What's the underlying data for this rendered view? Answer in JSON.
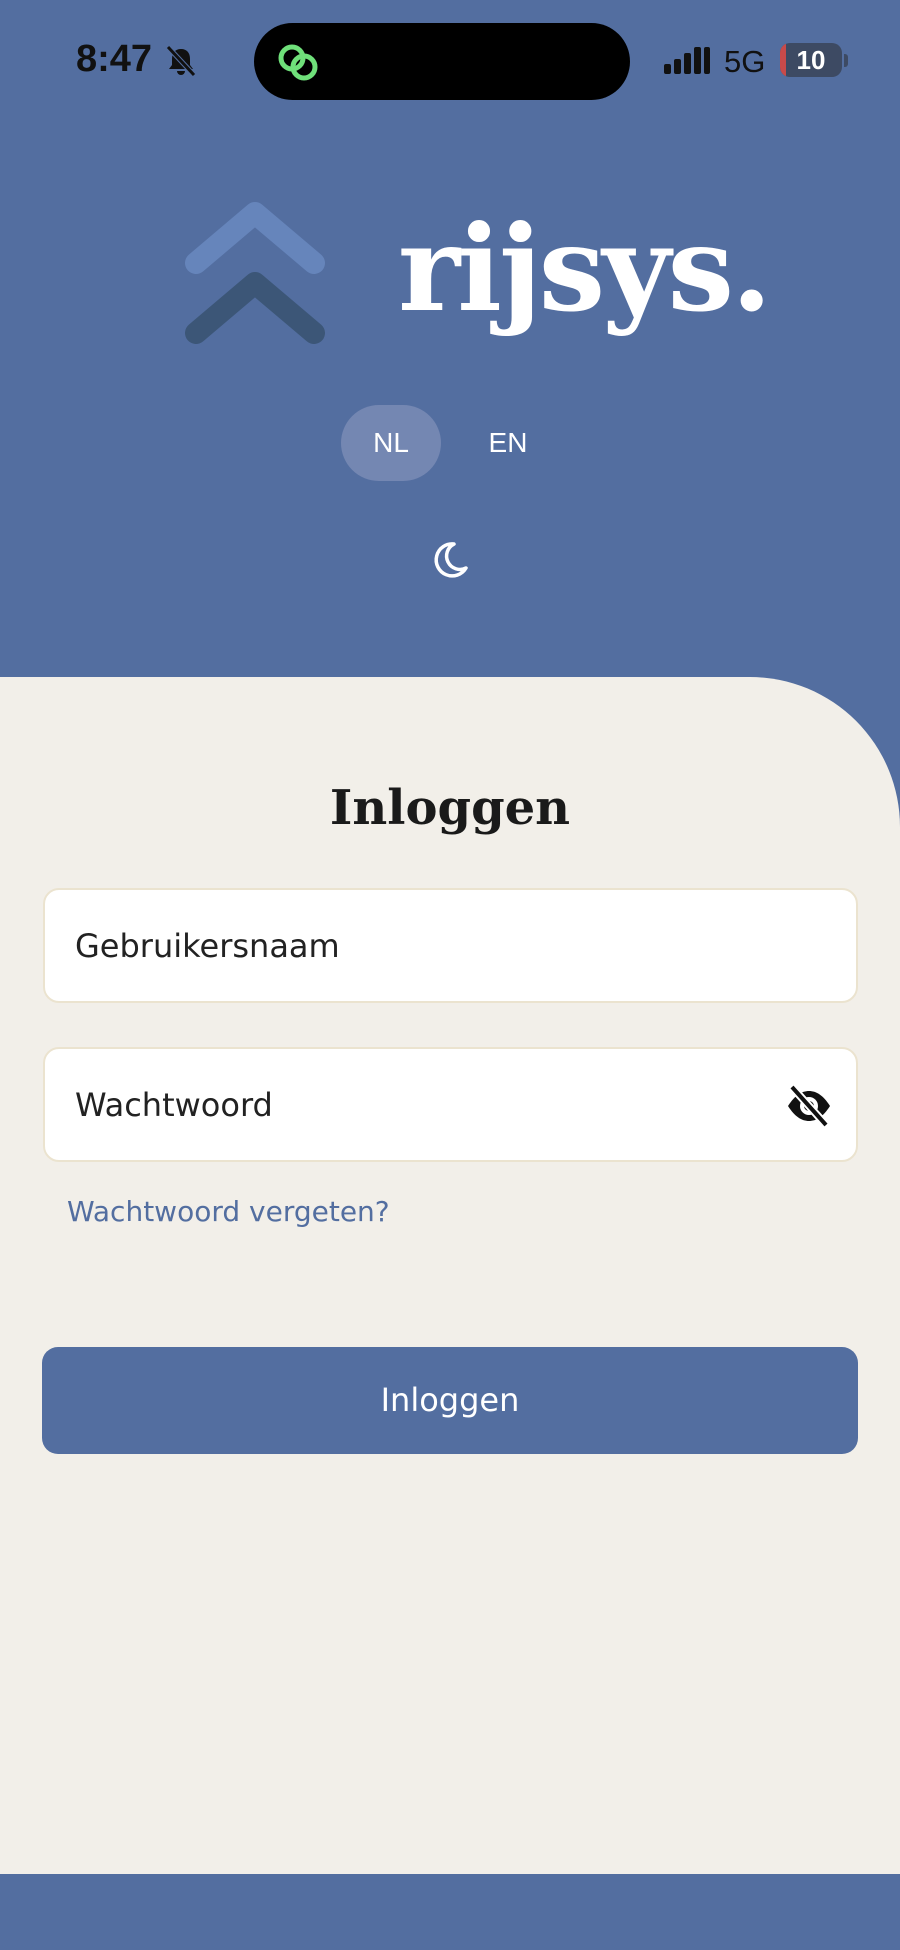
{
  "status_bar": {
    "time": "8:47",
    "network": "5G",
    "battery_level": "10",
    "battery_fraction": 0.1
  },
  "header": {
    "logo_text": "rijsys.",
    "languages": [
      "NL",
      "EN"
    ],
    "selected_language": "NL"
  },
  "login": {
    "title": "Inloggen",
    "username_placeholder": "Gebruikersnaam",
    "password_placeholder": "Wachtwoord",
    "forgot_password": "Wachtwoord vergeten?",
    "submit_label": "Inloggen"
  },
  "colors": {
    "brand": "#536ea0",
    "card_background": "#f2efe9",
    "field_border": "#ebe3cf"
  }
}
